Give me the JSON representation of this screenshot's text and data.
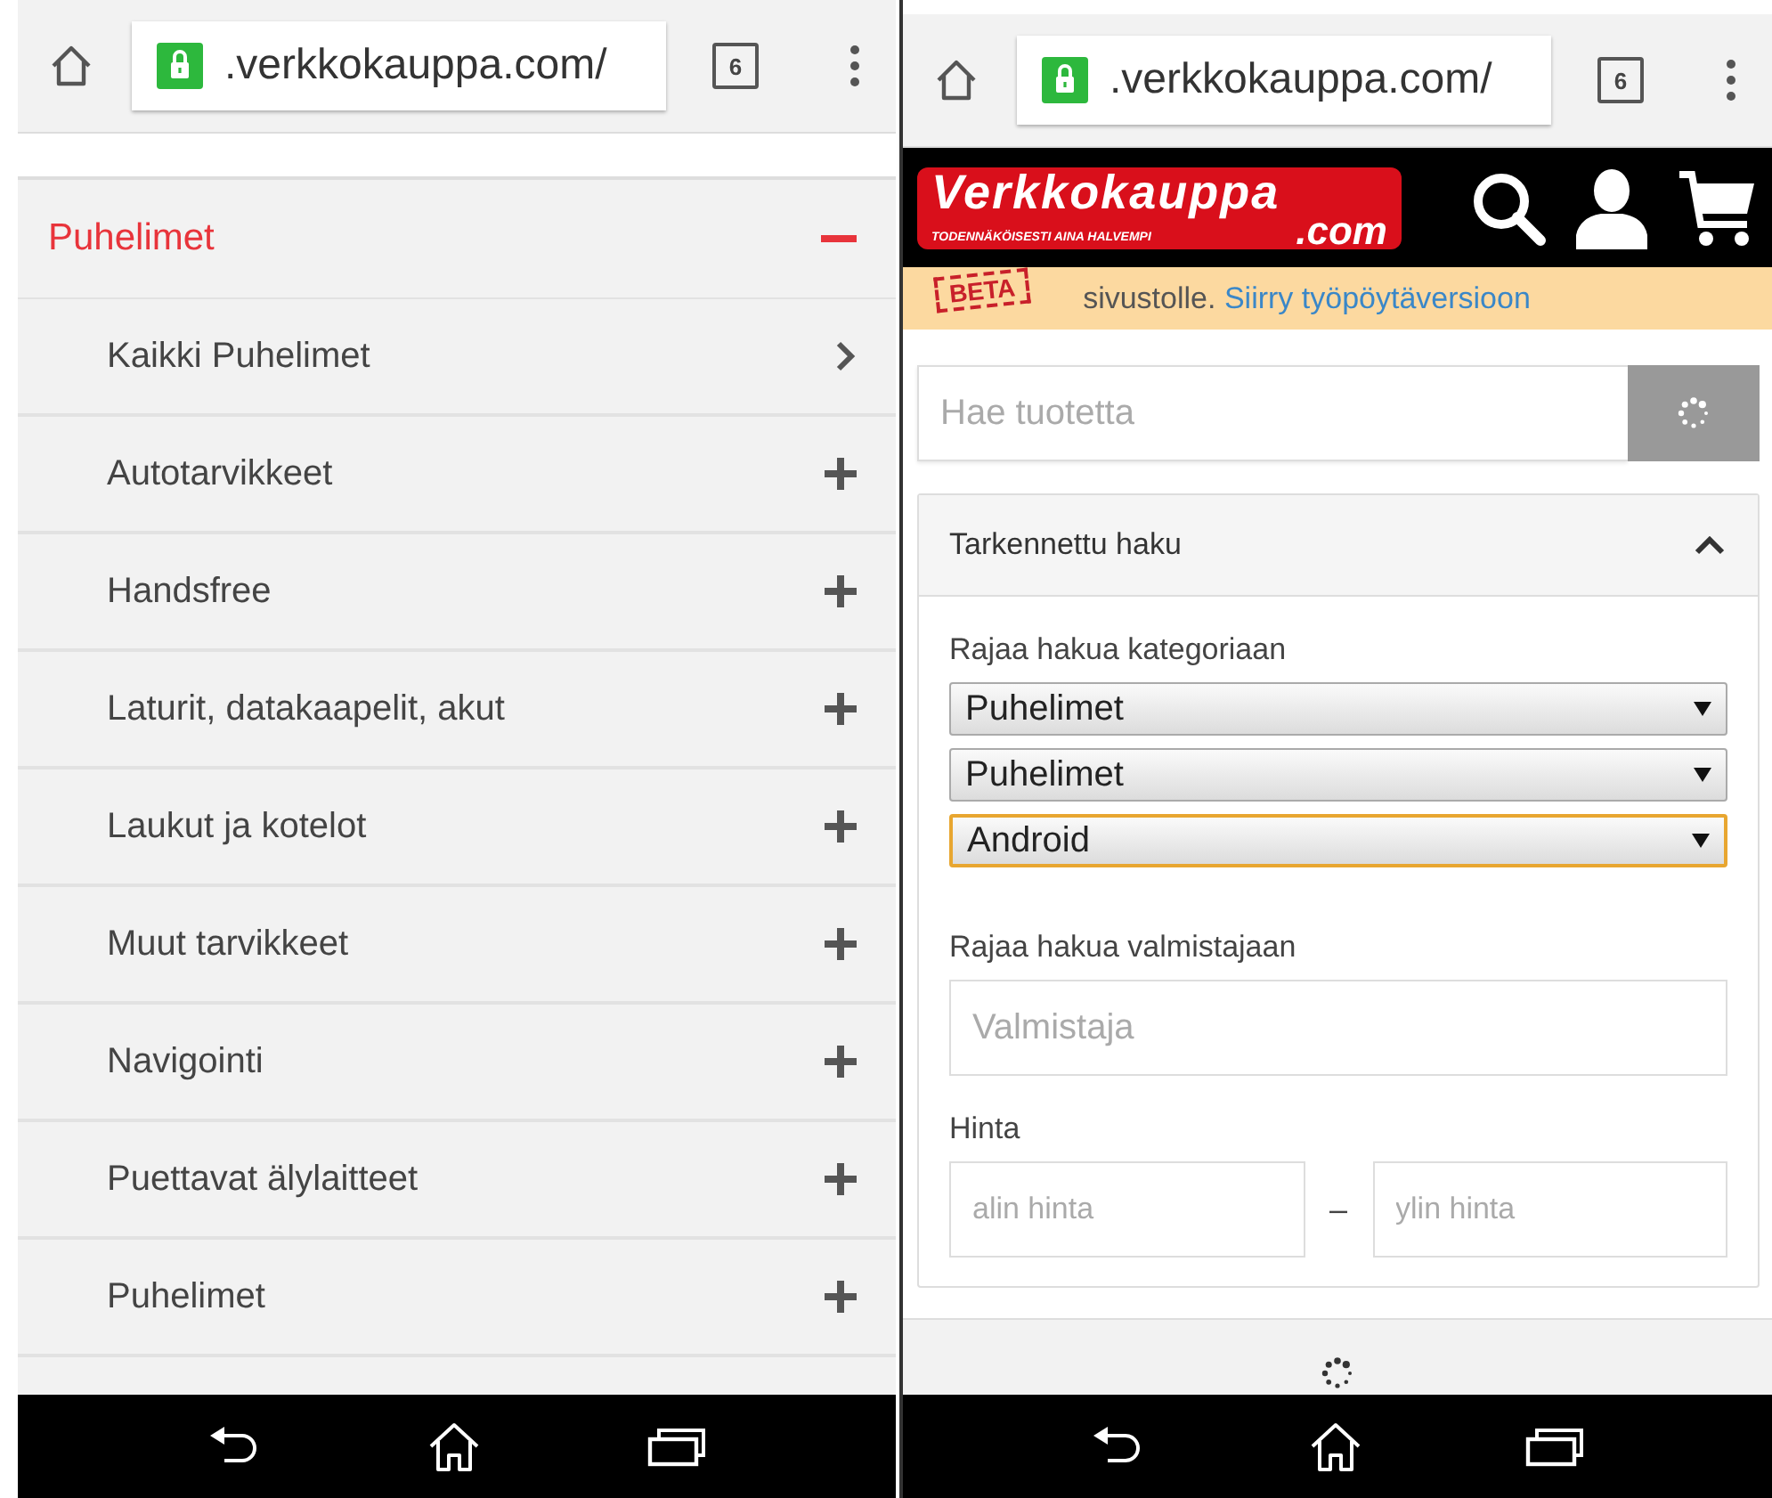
{
  "left_screen": {
    "browser": {
      "url": ".verkkokauppa.com/",
      "tab_count": "6"
    },
    "menu": {
      "category": {
        "label": "Puhelimet",
        "expanded": true
      },
      "items": [
        {
          "label": "Kaikki Puhelimet",
          "kind": "link"
        },
        {
          "label": "Autotarvikkeet",
          "kind": "expandable"
        },
        {
          "label": "Handsfree",
          "kind": "expandable"
        },
        {
          "label": "Laturit, datakaapelit, akut",
          "kind": "expandable"
        },
        {
          "label": "Laukut ja kotelot",
          "kind": "expandable"
        },
        {
          "label": "Muut tarvikkeet",
          "kind": "expandable"
        },
        {
          "label": "Navigointi",
          "kind": "expandable"
        },
        {
          "label": "Puettavat älylaitteet",
          "kind": "expandable"
        },
        {
          "label": "Puhelimet",
          "kind": "expandable"
        }
      ]
    }
  },
  "right_screen": {
    "browser": {
      "url": ".verkkokauppa.com/",
      "tab_count": "6"
    },
    "logo": {
      "name": "Verkkokauppa",
      "domain": ".com",
      "slogan": "TODENNÄKÖISESTI AINA HALVEMPI"
    },
    "banner": {
      "stamp": "BETA",
      "text": "sivustolle.",
      "link": "Siirry työpöytäversioon"
    },
    "search": {
      "placeholder": "Hae tuotetta"
    },
    "advanced": {
      "title": "Tarkennettu haku",
      "expanded": true,
      "category_label": "Rajaa hakua kategoriaan",
      "selects": [
        {
          "value": "Puhelimet",
          "focused": false
        },
        {
          "value": "Puhelimet",
          "focused": false
        },
        {
          "value": "Android",
          "focused": true
        }
      ],
      "maker_label": "Rajaa hakua valmistajaan",
      "maker": {
        "placeholder": "Valmistaja"
      },
      "price_label": "Hinta",
      "min": {
        "placeholder": "alin hinta"
      },
      "separator": "–",
      "max": {
        "placeholder": "ylin hinta"
      }
    }
  }
}
